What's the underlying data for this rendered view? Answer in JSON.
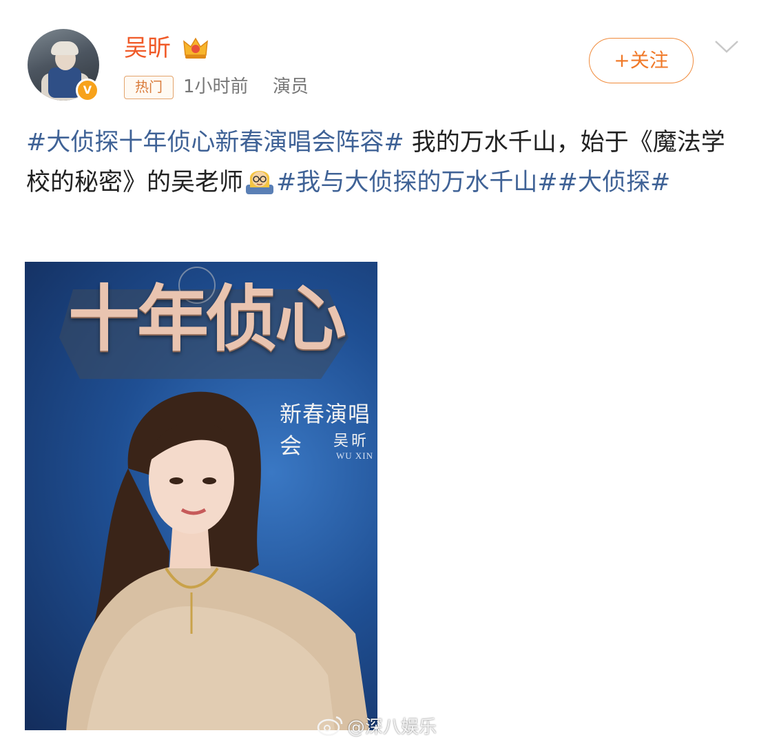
{
  "author": {
    "name": "吴昕",
    "avatar_icon": "avatar",
    "verified_icon": "verified-v-icon",
    "crown_icon": "crown-icon"
  },
  "meta": {
    "hot_tag": "热门",
    "time": "1小时前",
    "role": "演员"
  },
  "actions": {
    "follow_label": "+关注",
    "more_icon": "chevron-down-icon"
  },
  "post": {
    "hashtag_1": "#大侦探十年侦心新春演唱会阵容#",
    "text_1": " 我的万水千山，始于《魔法学校的秘密》的吴老师",
    "emoji": "teacher-emoji-icon",
    "hashtag_2": "#我与大侦探的万水千山#",
    "hashtag_3": "#大侦探#"
  },
  "poster": {
    "title": "十年侦心",
    "concert": "新春演唱会",
    "name": "吴昕",
    "pinyin": "WU XIN"
  },
  "watermark": {
    "logo_icon": "weibo-logo-icon",
    "handle": "@深八娱乐"
  },
  "colors": {
    "username": "#f05a28",
    "hashtag": "#3f6296",
    "follow_border": "#f08a3a",
    "meta_text": "#777777"
  }
}
